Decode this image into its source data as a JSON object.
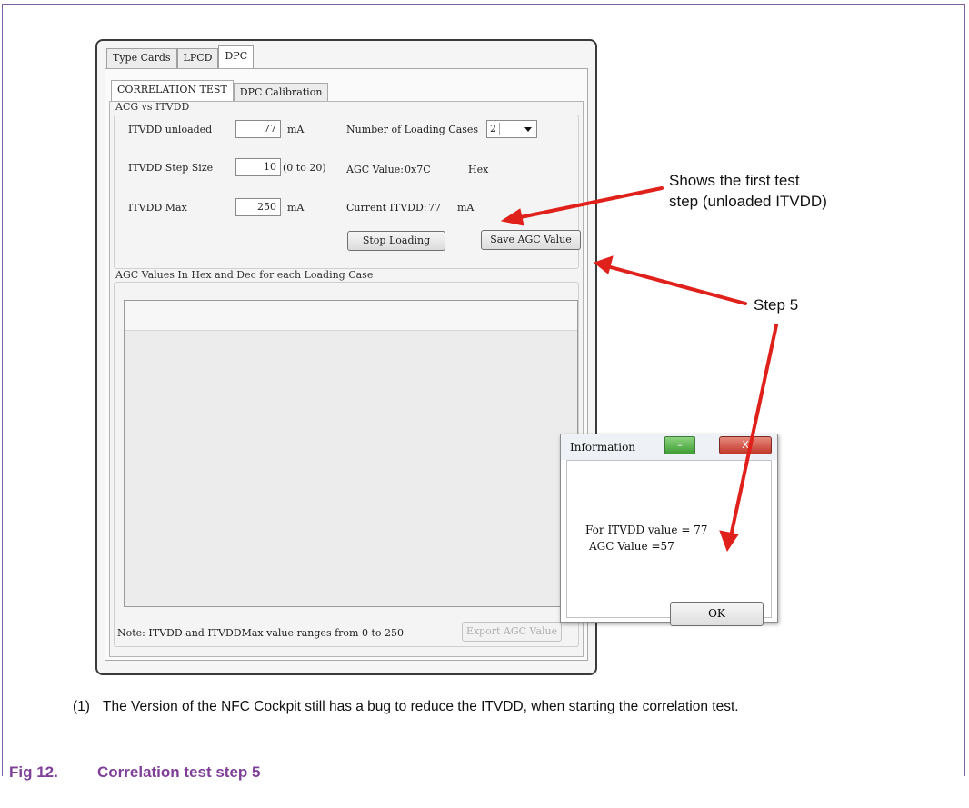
{
  "window": {
    "tabs": [
      "Type Cards",
      "LPCD",
      "DPC"
    ],
    "active_tab": "DPC",
    "subtabs": [
      "CORRELATION TEST",
      "DPC Calibration"
    ],
    "active_subtab": "CORRELATION TEST",
    "group_title": "ACG vs ITVDD",
    "itvdd_unloaded": {
      "label": "ITVDD unloaded",
      "value": "77",
      "unit": "mA"
    },
    "itvdd_step": {
      "label": "ITVDD Step Size",
      "value": "10",
      "range": "(0 to 20)"
    },
    "itvdd_max": {
      "label": "ITVDD Max",
      "value": "250",
      "unit": "mA"
    },
    "loading_cases": {
      "label": "Number of Loading Cases",
      "value": "2"
    },
    "agc_value": {
      "label": "AGC Value:",
      "value": "0x7C",
      "unit": "Hex"
    },
    "current_itvdd": {
      "label": "Current ITVDD:",
      "value": "77",
      "unit": "mA"
    },
    "stop_button": "Stop Loading",
    "save_button": "Save AGC Value",
    "table_title": "AGC Values In Hex and Dec for each Loading Case",
    "note": "Note: ITVDD and ITVDDMax value ranges from 0 to 250",
    "export_button": "Export AGC Value"
  },
  "annotations": {
    "first_step_line1": "Shows the first test",
    "first_step_line2": "step (unloaded ITVDD)",
    "step5": "Step 5",
    "arrow_color": "#e0201b"
  },
  "dialog": {
    "title": "Information",
    "minimize_glyph": "–",
    "close_glyph": "X",
    "line1": "For ITVDD value = 77",
    "line2": "AGC Value =57",
    "ok": "OK"
  },
  "footnote": {
    "number": "(1)",
    "text": "The Version of the NFC Cockpit still has a bug to reduce the ITVDD, when starting the correlation test."
  },
  "figure": {
    "number": "Fig 12.",
    "title": "Correlation test step 5",
    "color": "#7f3f98"
  }
}
